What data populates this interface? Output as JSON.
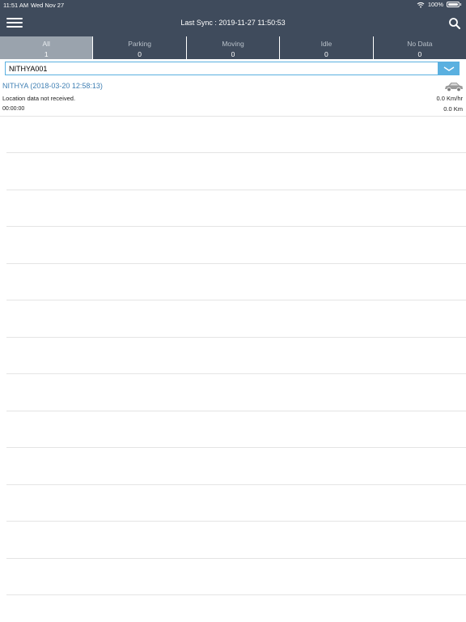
{
  "status_bar": {
    "time": "11:51 AM",
    "date": "Wed Nov 27",
    "battery": "100%"
  },
  "header": {
    "title": "Last Sync : 2019-11-27 11:50:53"
  },
  "tabs": [
    {
      "label": "All",
      "count": "1"
    },
    {
      "label": "Parking",
      "count": "0"
    },
    {
      "label": "Moving",
      "count": "0"
    },
    {
      "label": "Idle",
      "count": "0"
    },
    {
      "label": "No Data",
      "count": "0"
    }
  ],
  "vehicle_select": {
    "value": "NITHYA001"
  },
  "vehicle": {
    "name": "NITHYA (2018-03-20 12:58:13)",
    "location": "Location data not received.",
    "duration": "00:00:00",
    "speed": "0.0 Km/hr",
    "distance": "0.0 Km"
  },
  "colors": {
    "header": "#3f4b5c",
    "active_tab": "#9aa3ad",
    "accent": "#5ab0e0",
    "link": "#3f7fb3"
  },
  "icons": [
    "menu-icon",
    "search-icon",
    "wifi-icon",
    "battery-icon",
    "chevron-down-icon",
    "car-icon"
  ]
}
